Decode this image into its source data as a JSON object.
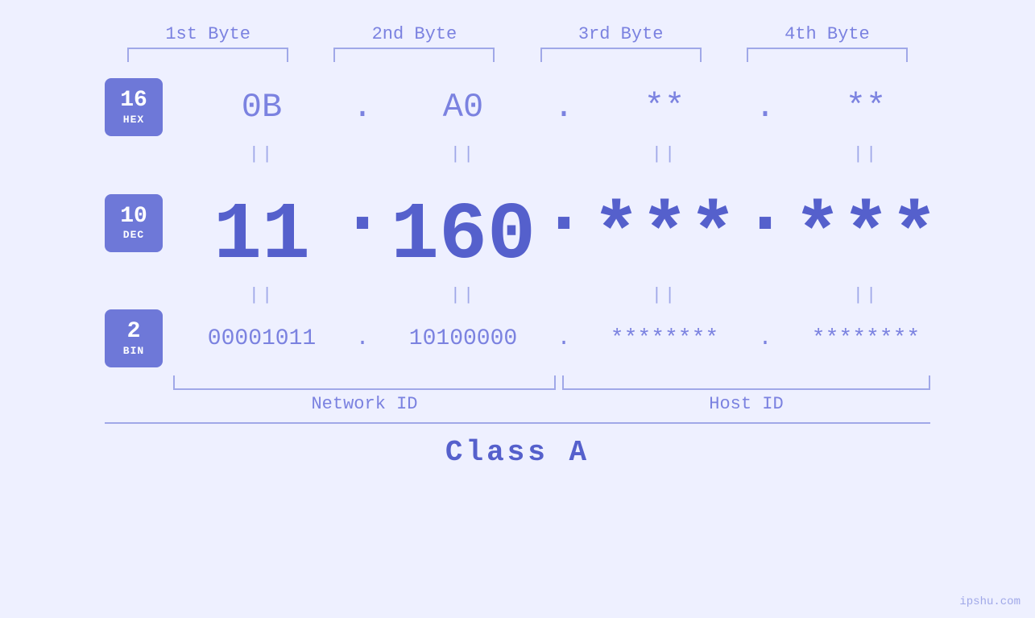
{
  "header": {
    "bytes": [
      "1st Byte",
      "2nd Byte",
      "3rd Byte",
      "4th Byte"
    ]
  },
  "badges": [
    {
      "num": "16",
      "label": "HEX"
    },
    {
      "num": "10",
      "label": "DEC"
    },
    {
      "num": "2",
      "label": "BIN"
    }
  ],
  "hex_row": {
    "values": [
      "0B",
      "A0",
      "**",
      "**"
    ],
    "dots": [
      ".",
      ".",
      ".",
      ""
    ]
  },
  "dec_row": {
    "values": [
      "11",
      "160",
      "***",
      "***"
    ],
    "dots": [
      ".",
      ".",
      ".",
      ""
    ]
  },
  "bin_row": {
    "values": [
      "00001011",
      "10100000",
      "********",
      "********"
    ],
    "dots": [
      ".",
      ".",
      ".",
      ""
    ]
  },
  "labels": {
    "network_id": "Network ID",
    "host_id": "Host ID"
  },
  "class_label": "Class A",
  "watermark": "ipshu.com"
}
